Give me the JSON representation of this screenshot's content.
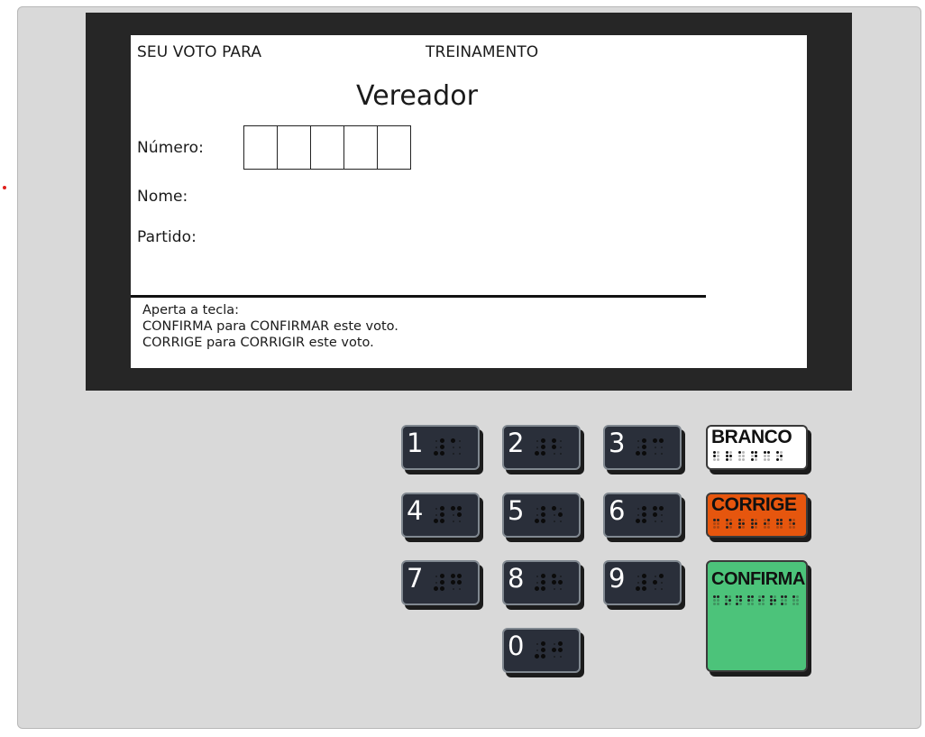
{
  "screen": {
    "seu_voto": "SEU VOTO PARA",
    "mode": "TREINAMENTO",
    "cargo": "Vereador",
    "numero_label": "Número:",
    "nome_label": "Nome:",
    "partido_label": "Partido:",
    "instructions": [
      "Aperta a tecla:",
      "CONFIRMA para CONFIRMAR este voto.",
      "CORRIGE para CORRIGIR este voto."
    ]
  },
  "keypad": {
    "keys": [
      "1",
      "2",
      "3",
      "4",
      "5",
      "6",
      "7",
      "8",
      "9",
      "0"
    ]
  },
  "function_keys": {
    "branco": "BRANCO",
    "corrige": "CORRIGE",
    "confirma": "CONFIRMA"
  },
  "colors": {
    "branco": "#ffffff",
    "corrige": "#e6560e",
    "confirma": "#4cc37a",
    "key_bg": "#2a2f3a",
    "bezel": "#262626",
    "panel": "#d9d9d9"
  }
}
